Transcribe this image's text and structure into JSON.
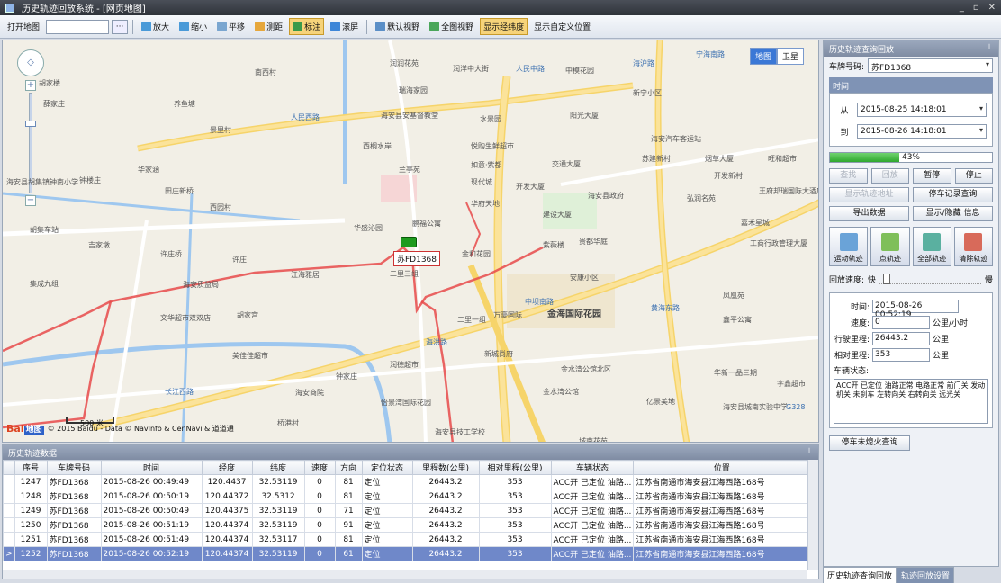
{
  "window": {
    "title": "历史轨迹回放系统 - [网页地图]"
  },
  "toolbar": {
    "open_map": "打开地图",
    "ellipsis": "···",
    "zoom_in": "放大",
    "zoom_out": "缩小",
    "pan": "平移",
    "measure": "测距",
    "mark": "标注",
    "roam": "滚屏",
    "default_view": "默认视野",
    "full_view": "全图视野",
    "show_latlon": "显示经纬度",
    "custom_pos": "显示自定义位置"
  },
  "map": {
    "type_map": "地图",
    "type_satellite": "卫星",
    "car_plate": "苏FD1368",
    "scale": "500 米",
    "copyright": "© 2015 Baidu - Data © NavInfo & CenNavi & 道道通",
    "baidu_logo": "Bai",
    "baidu_logo2": "地图",
    "labels": [
      "南西村",
      "胡家楼",
      "薛家庄",
      "养鱼塘",
      "景里村",
      "钟楼庄",
      "华家涵",
      "田庄新桥",
      "海安县胡集镇钟南小学",
      "胡集车站",
      "西园村",
      "吉家墩",
      "许庄桥",
      "许庄",
      "集成九组",
      "海安质监局",
      "文华超市双双店",
      "胡家宫",
      "美佳佳超市",
      "钟家庄",
      "长江西路",
      "海安商院",
      "瑞海家园",
      "润润花苑",
      "润洋中大街",
      "人民中路",
      "人民西路",
      "海安县安基督教堂",
      "水景园",
      "悦购生鲜超市",
      "如意·紫都",
      "交通大厦",
      "现代城",
      "开发大厦",
      "华府天地",
      "海安县政府",
      "建设大厦",
      "华盛沁园",
      "鹏福公寓",
      "金和花园",
      "紫薇楼",
      "兰亭苑",
      "西桐水岸",
      "二里三组",
      "江海雅居",
      "二里一组",
      "万豪国际",
      "金海国际花园",
      "新城尚府",
      "润德超市",
      "金水湾公馆北区",
      "金水湾公馆",
      "怡景湾国际花园",
      "桥港村",
      "海安县技工学校",
      "城南花苑",
      "中模花园",
      "新宁小区",
      "阳光大厦",
      "海安汽车客运站",
      "苏建新村",
      "烟草大厦",
      "开发新村",
      "旺和超市",
      "弘润名苑",
      "王府邦瑞国际大酒店",
      "嘉禾星城",
      "工商行政管理大厦",
      "贵都华庭",
      "安康小区",
      "凤凰苑",
      "鑫平公寓",
      "华新一品三期",
      "亿景美地",
      "海安县城南实验中学",
      "字鑫超市",
      "黄海东路",
      "G328",
      "宁海南路",
      "中坝南路",
      "海洪路",
      "海沪路"
    ]
  },
  "side": {
    "panel_title": "历史轨迹查询回放",
    "plate_label": "车牌号码:",
    "plate_value": "苏FD1368",
    "time_group": "时间",
    "from_label": "从",
    "from_value": "2015-08-25 14:18:01",
    "to_label": "到",
    "to_value": "2015-08-26 14:18:01",
    "progress_text": "43%",
    "progress": 0.43,
    "btn_query": "查找",
    "btn_replay": "回放",
    "btn_pause": "暂停",
    "btn_stop": "停止",
    "btn_show_addr": "显示轨迹地址",
    "btn_stop_records": "停车记录查询",
    "btn_export": "导出数据",
    "btn_toggle_info": "显示/隐藏 信息",
    "btn_motion": "运动轨迹",
    "btn_point": "点轨迹",
    "btn_all": "全部轨迹",
    "btn_clear": "清除轨迹",
    "speed_label": "回放速度:",
    "fast": "快",
    "slow": "慢",
    "time_label": "时间:",
    "time_value": "2015-08-26 00:52:19",
    "speed_field_label": "速度:",
    "speed_value": "0",
    "speed_unit": "公里/小时",
    "mileage_label": "行驶里程:",
    "mileage_value": "26443.2",
    "mileage_unit": "公里",
    "rel_label": "相对里程:",
    "rel_value": "353",
    "rel_unit": "公里",
    "status_label": "车辆状态:",
    "status_value": "ACC开 已定位 油路正常 电路正常 前门关 发动机关 未刹车 左转向关 右转向关 远光关",
    "btn_no_flameout": "停车未熄火查询",
    "tab1": "历史轨迹查询回放",
    "tab2": "轨迹回放设置"
  },
  "grid": {
    "title": "历史轨迹数据",
    "columns": [
      "序号",
      "车牌号码",
      "时间",
      "经度",
      "纬度",
      "速度",
      "方向",
      "定位状态",
      "里程数(公里)",
      "相对里程(公里)",
      "车辆状态",
      "位置"
    ],
    "rows": [
      [
        "1247",
        "苏FD1368",
        "2015-08-26 00:49:49",
        "120.4437",
        "32.53119",
        "0",
        "81",
        "定位",
        "26443.2",
        "353",
        "ACC开 已定位 油路...",
        "江苏省南通市海安县江海西路168号"
      ],
      [
        "1248",
        "苏FD1368",
        "2015-08-26 00:50:19",
        "120.44372",
        "32.5312",
        "0",
        "81",
        "定位",
        "26443.2",
        "353",
        "ACC开 已定位 油路...",
        "江苏省南通市海安县江海西路168号"
      ],
      [
        "1249",
        "苏FD1368",
        "2015-08-26 00:50:49",
        "120.44375",
        "32.53119",
        "0",
        "71",
        "定位",
        "26443.2",
        "353",
        "ACC开 已定位 油路...",
        "江苏省南通市海安县江海西路168号"
      ],
      [
        "1250",
        "苏FD1368",
        "2015-08-26 00:51:19",
        "120.44374",
        "32.53119",
        "0",
        "91",
        "定位",
        "26443.2",
        "353",
        "ACC开 已定位 油路...",
        "江苏省南通市海安县江海西路168号"
      ],
      [
        "1251",
        "苏FD1368",
        "2015-08-26 00:51:49",
        "120.44374",
        "32.53117",
        "0",
        "81",
        "定位",
        "26443.2",
        "353",
        "ACC开 已定位 油路...",
        "江苏省南通市海安县江海西路168号"
      ],
      [
        "1252",
        "苏FD1368",
        "2015-08-26 00:52:19",
        "120.44374",
        "32.53119",
        "0",
        "61",
        "定位",
        "26443.2",
        "353",
        "ACC开 已定位 油路...",
        "江苏省南通市海安县江海西路168号"
      ]
    ],
    "selected_index": 5
  }
}
